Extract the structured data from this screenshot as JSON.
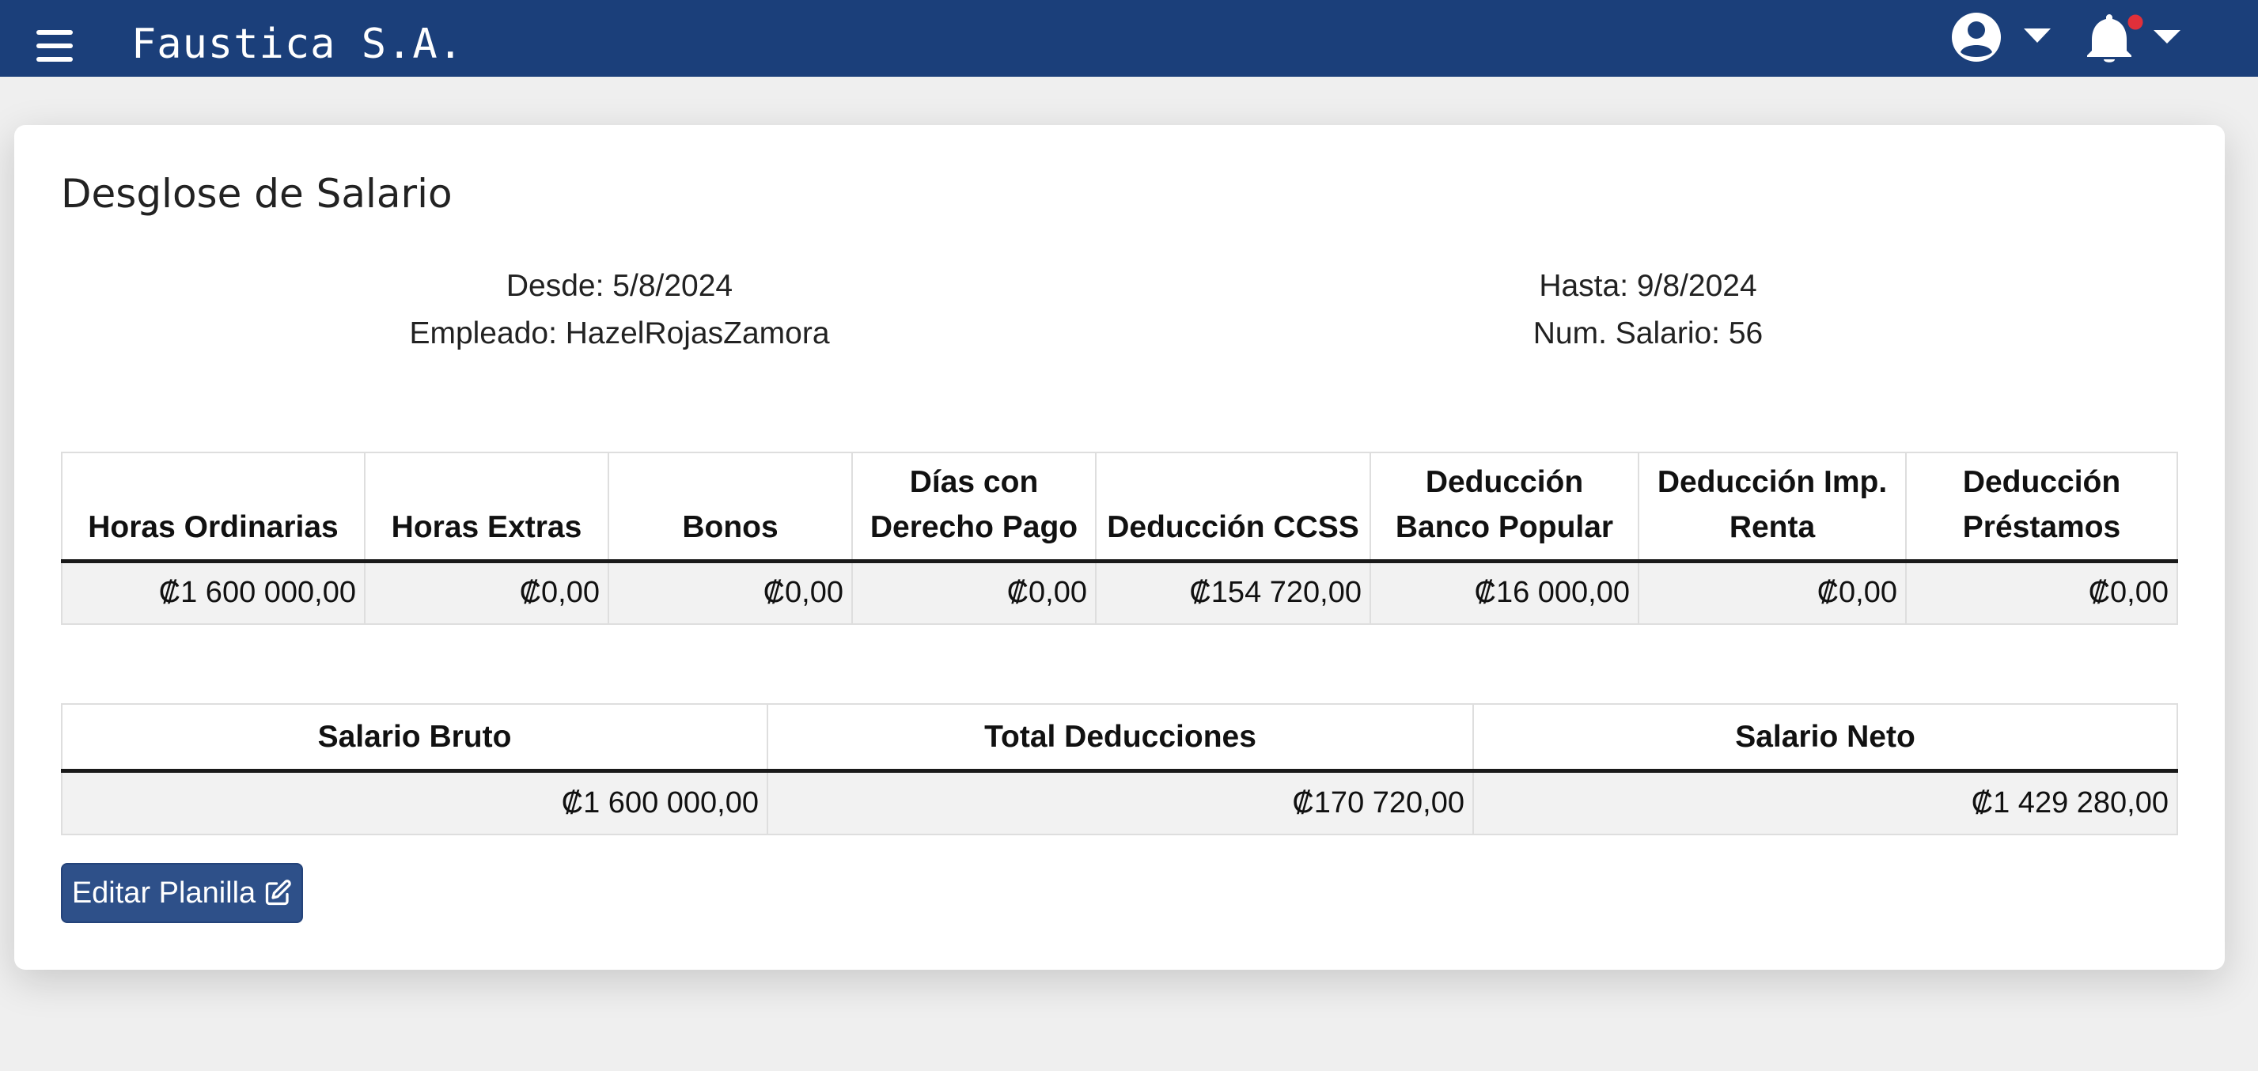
{
  "header": {
    "brand": "Faustica S.A.",
    "menu_icon": "hamburger-menu-icon",
    "user_icon": "user-circle-icon",
    "notifications_icon": "bell-icon",
    "notification_badge_color": "#e0303a",
    "bar_color": "#1b3f7a"
  },
  "page": {
    "title": "Desglose de Salario",
    "desde": "Desde: 5/8/2024",
    "empleado": "Empleado: HazelRojasZamora",
    "hasta": "Hasta: 9/8/2024",
    "num_salario": "Num. Salario: 56"
  },
  "detail_table": {
    "columns": [
      "Horas Ordinarias",
      "Horas Extras",
      "Bonos",
      "Días con Derecho Pago",
      "Deducción CCSS",
      "Deducción Banco Popular",
      "Deducción Imp. Renta",
      "Deducción Préstamos"
    ],
    "row": [
      "₡1 600 000,00",
      "₡0,00",
      "₡0,00",
      "₡0,00",
      "₡154 720,00",
      "₡16 000,00",
      "₡0,00",
      "₡0,00"
    ]
  },
  "summary_table": {
    "columns": [
      "Salario Bruto",
      "Total Deducciones",
      "Salario Neto"
    ],
    "row": [
      "₡1 600 000,00",
      "₡170 720,00",
      "₡1 429 280,00"
    ]
  },
  "actions": {
    "edit_label": "Editar Planilla",
    "edit_icon": "edit-icon",
    "button_color": "#2e5089"
  }
}
